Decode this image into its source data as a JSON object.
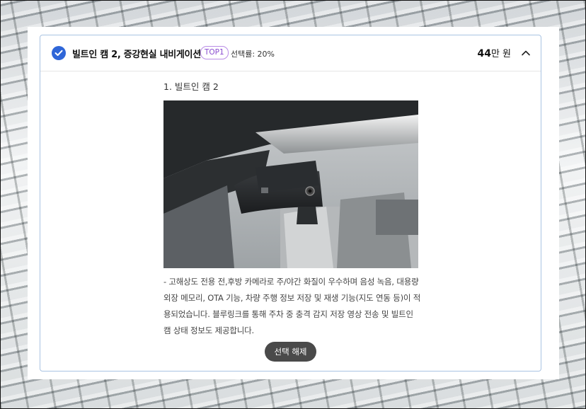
{
  "option": {
    "title": "빌트인 캠 2, 증강현실 내비게이션",
    "badge": "TOP1",
    "selection_rate": "선택률: 20%",
    "price_number": "44",
    "price_unit": "만 원"
  },
  "detail": {
    "item_label": "1. 빌트인 캠 2",
    "description": "- 고해상도 전용 전,후방 카메라로 주/야간 화질이 우수하며 음성 녹음, 대용량 외장 메모리, OTA 기능, 차량 주행 정보 저장 및 재생 기능(지도 연동 등)이 적용되었습니다. 블루링크를 통해 주차 중 충격 감지 저장 영상 전송 및 빌트인 캠 상태 정보도 제공합니다.",
    "deselect_label": "선택 해제"
  },
  "icons": {
    "check": "check-circle-icon",
    "collapse": "chevron-up-icon"
  },
  "colors": {
    "accent": "#2f66d8",
    "badge": "#8a4cd0",
    "card_border": "#a9c3e2",
    "button_bg": "#4a4a4a"
  }
}
